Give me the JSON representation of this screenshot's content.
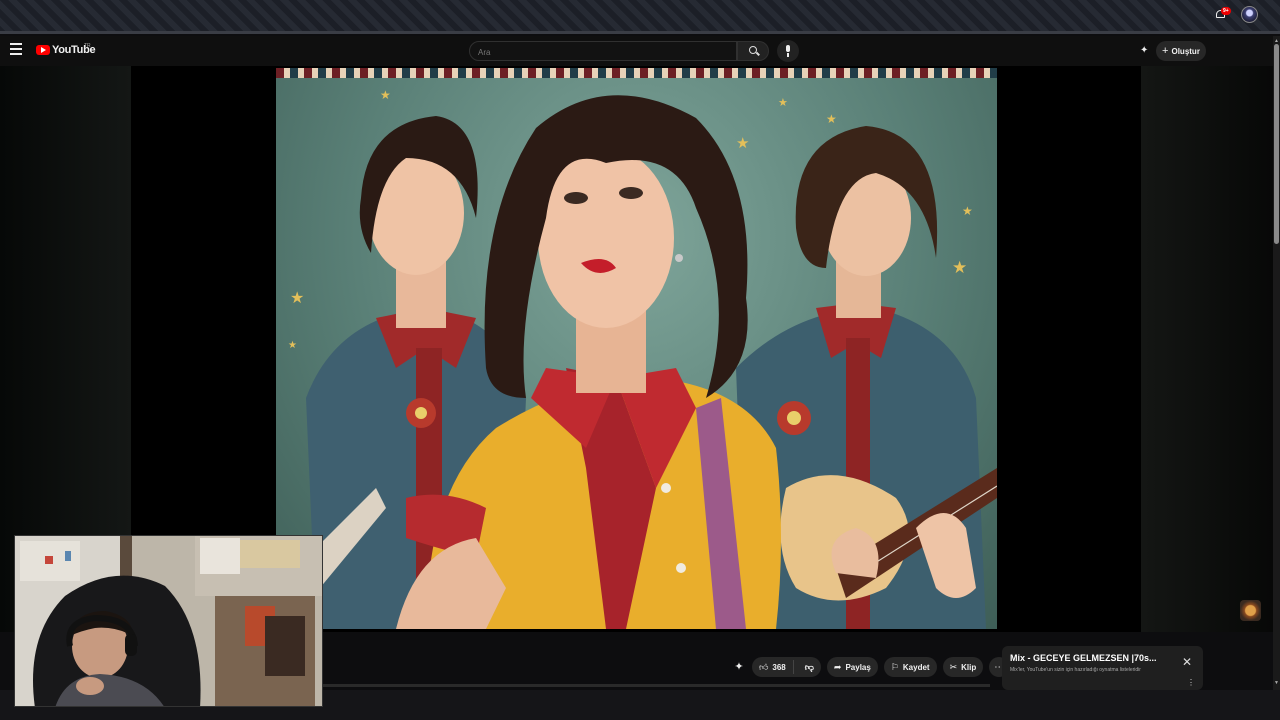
{
  "app": {
    "name": "YouTube",
    "region": "TR"
  },
  "search": {
    "placeholder": "Ara",
    "value": ""
  },
  "header": {
    "create_label": "Oluştur",
    "notification_badge": "9+"
  },
  "actions": {
    "like_count": "368",
    "share_label": "Paylaş",
    "save_label": "Kaydet",
    "clip_label": "Klip"
  },
  "mix_card": {
    "title": "Mix - GECEYE GELMEZSEN |70s...",
    "subtitle": "Mix'ler, YouTube'un sizin için hazırladığı oynatma listeleridir"
  },
  "colors": {
    "accent": "#ff0000",
    "badge": "#ee0000"
  },
  "icons": [
    "menu-icon",
    "youtube-logo-icon",
    "search-icon",
    "mic-icon",
    "create-icon",
    "bell-icon",
    "like-icon",
    "dislike-icon",
    "share-icon",
    "save-icon",
    "clip-icon",
    "more-icon",
    "close-icon"
  ]
}
